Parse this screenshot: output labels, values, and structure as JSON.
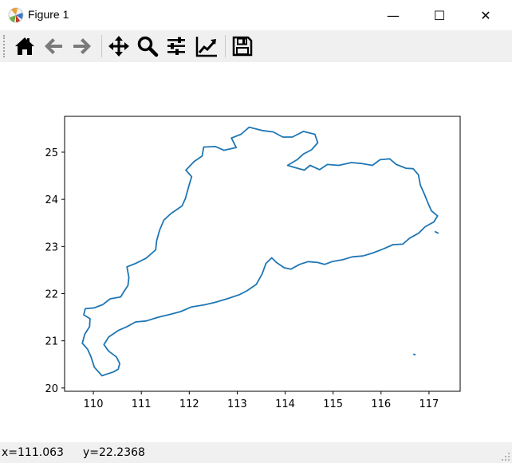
{
  "window": {
    "title": "Figure 1",
    "controls": {
      "minimize": "—",
      "maximize": "☐",
      "close": "✕"
    }
  },
  "toolbar": {
    "tools": [
      {
        "name": "home",
        "icon": "home-icon"
      },
      {
        "name": "back",
        "icon": "arrow-left-icon"
      },
      {
        "name": "forward",
        "icon": "arrow-right-icon"
      },
      {
        "name": "pan",
        "icon": "move-icon"
      },
      {
        "name": "zoom",
        "icon": "magnifier-icon"
      },
      {
        "name": "subplots",
        "icon": "sliders-icon"
      },
      {
        "name": "edit-axis",
        "icon": "line-chart-icon"
      },
      {
        "name": "save",
        "icon": "floppy-disk-icon"
      }
    ],
    "colors": {
      "icon": "#000000",
      "disabled_icon": "#7a7a7a"
    }
  },
  "status": {
    "x_readout": "x=111.063",
    "y_readout": "y=22.2368"
  },
  "chart_data": {
    "type": "line",
    "title": "",
    "xlabel": "",
    "ylabel": "",
    "xlim": [
      109.4,
      117.65
    ],
    "ylim": [
      19.93,
      25.76
    ],
    "xticks": [
      110,
      111,
      112,
      113,
      114,
      115,
      116,
      117
    ],
    "yticks": [
      20,
      21,
      22,
      23,
      24,
      25
    ],
    "grid": false,
    "line_color": "#1f77b4",
    "series": [
      {
        "values_xy": [
          [
            110.42,
            20.34
          ],
          [
            110.18,
            20.26
          ],
          [
            110.02,
            20.44
          ],
          [
            109.95,
            20.66
          ],
          [
            109.88,
            20.82
          ],
          [
            109.77,
            20.95
          ],
          [
            109.82,
            21.14
          ],
          [
            109.92,
            21.3
          ],
          [
            109.93,
            21.47
          ],
          [
            109.8,
            21.55
          ],
          [
            109.83,
            21.68
          ],
          [
            110.02,
            21.7
          ],
          [
            110.2,
            21.77
          ],
          [
            110.35,
            21.89
          ],
          [
            110.57,
            21.93
          ],
          [
            110.64,
            22.05
          ],
          [
            110.72,
            22.17
          ],
          [
            110.74,
            22.34
          ],
          [
            110.7,
            22.57
          ],
          [
            110.88,
            22.64
          ],
          [
            111.1,
            22.75
          ],
          [
            111.3,
            22.93
          ],
          [
            111.32,
            23.12
          ],
          [
            111.38,
            23.34
          ],
          [
            111.47,
            23.56
          ],
          [
            111.62,
            23.7
          ],
          [
            111.85,
            23.86
          ],
          [
            111.92,
            24.02
          ],
          [
            111.98,
            24.24
          ],
          [
            112.05,
            24.48
          ],
          [
            111.93,
            24.62
          ],
          [
            112.1,
            24.8
          ],
          [
            112.27,
            24.92
          ],
          [
            112.3,
            25.11
          ],
          [
            112.55,
            25.12
          ],
          [
            112.72,
            25.04
          ],
          [
            112.98,
            25.1
          ],
          [
            112.88,
            25.3
          ],
          [
            113.08,
            25.38
          ],
          [
            113.25,
            25.53
          ],
          [
            113.52,
            25.46
          ],
          [
            113.75,
            25.43
          ],
          [
            113.95,
            25.32
          ],
          [
            114.15,
            25.32
          ],
          [
            114.38,
            25.44
          ],
          [
            114.62,
            25.38
          ],
          [
            114.68,
            25.2
          ],
          [
            114.55,
            25.05
          ],
          [
            114.38,
            24.96
          ],
          [
            114.25,
            24.84
          ],
          [
            114.05,
            24.72
          ],
          [
            114.18,
            24.68
          ],
          [
            114.4,
            24.62
          ],
          [
            114.52,
            24.72
          ],
          [
            114.72,
            24.63
          ],
          [
            114.88,
            24.74
          ],
          [
            115.12,
            24.72
          ],
          [
            115.38,
            24.78
          ],
          [
            115.6,
            24.76
          ],
          [
            115.82,
            24.72
          ],
          [
            115.98,
            24.84
          ],
          [
            116.18,
            24.86
          ],
          [
            116.32,
            24.74
          ],
          [
            116.52,
            24.66
          ],
          [
            116.67,
            24.65
          ],
          [
            116.78,
            24.52
          ],
          [
            116.82,
            24.3
          ],
          [
            116.9,
            24.12
          ],
          [
            116.98,
            23.92
          ],
          [
            117.05,
            23.76
          ],
          [
            117.18,
            23.65
          ],
          [
            117.1,
            23.52
          ],
          [
            116.92,
            23.42
          ],
          [
            116.78,
            23.28
          ],
          [
            116.6,
            23.18
          ],
          [
            116.45,
            23.05
          ],
          [
            116.25,
            23.04
          ],
          [
            116.05,
            22.95
          ],
          [
            115.82,
            22.86
          ],
          [
            115.62,
            22.8
          ],
          [
            115.4,
            22.78
          ],
          [
            115.2,
            22.72
          ],
          [
            114.98,
            22.68
          ],
          [
            114.82,
            22.62
          ],
          [
            114.68,
            22.66
          ],
          [
            114.48,
            22.68
          ],
          [
            114.3,
            22.62
          ],
          [
            114.12,
            22.52
          ],
          [
            113.98,
            22.55
          ],
          [
            113.82,
            22.66
          ],
          [
            113.72,
            22.76
          ],
          [
            113.6,
            22.64
          ],
          [
            113.52,
            22.42
          ],
          [
            113.4,
            22.2
          ],
          [
            113.2,
            22.06
          ],
          [
            113.05,
            21.98
          ],
          [
            112.82,
            21.9
          ],
          [
            112.55,
            21.82
          ],
          [
            112.3,
            21.76
          ],
          [
            112.05,
            21.72
          ],
          [
            111.82,
            21.62
          ],
          [
            111.6,
            21.56
          ],
          [
            111.35,
            21.5
          ],
          [
            111.1,
            21.42
          ],
          [
            110.88,
            21.4
          ],
          [
            110.7,
            21.3
          ],
          [
            110.52,
            21.22
          ],
          [
            110.32,
            21.08
          ],
          [
            110.22,
            20.92
          ],
          [
            110.32,
            20.78
          ],
          [
            110.48,
            20.66
          ],
          [
            110.55,
            20.52
          ],
          [
            110.52,
            20.4
          ],
          [
            110.42,
            20.34
          ]
        ]
      }
    ],
    "islands": [
      [
        [
          116.67,
          20.72
        ],
        [
          116.72,
          20.7
        ]
      ],
      [
        [
          117.12,
          23.32
        ],
        [
          117.2,
          23.28
        ]
      ]
    ]
  }
}
